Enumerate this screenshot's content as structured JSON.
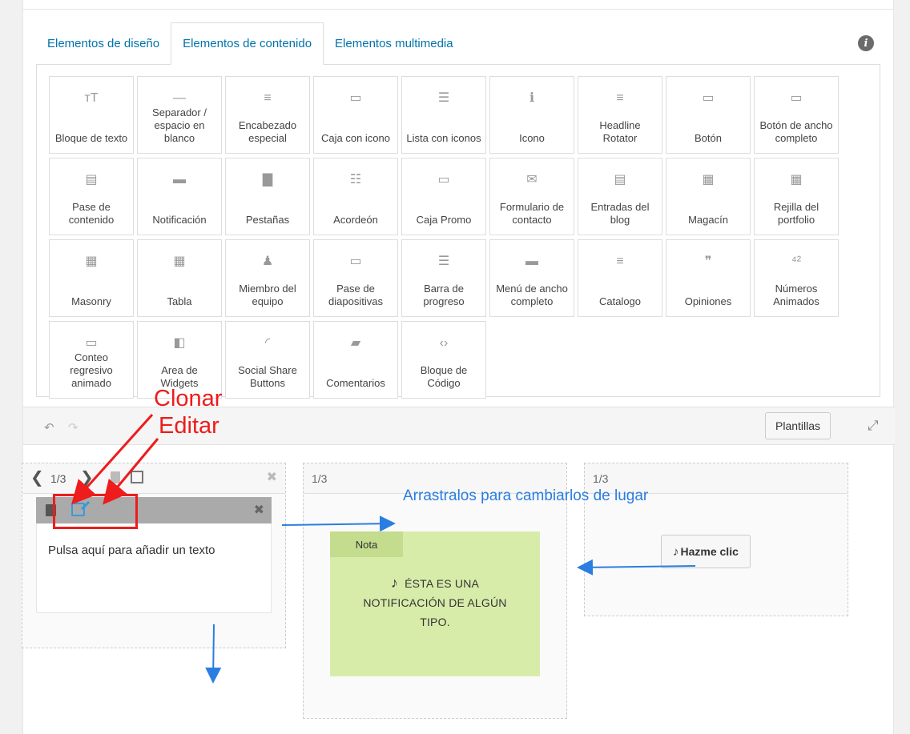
{
  "tabs": [
    {
      "label": "Elementos de diseño",
      "active": false
    },
    {
      "label": "Elementos de contenido",
      "active": true
    },
    {
      "label": "Elementos multimedia",
      "active": false
    }
  ],
  "elements": [
    {
      "label": "Bloque de texto",
      "icon": "text-block-icon",
      "glyph": "ᴛT"
    },
    {
      "label": "Separador / espacio en blanco",
      "icon": "separator-icon",
      "glyph": "—"
    },
    {
      "label": "Encabezado especial",
      "icon": "heading-icon",
      "glyph": "≡"
    },
    {
      "label": "Caja con icono",
      "icon": "icon-box-icon",
      "glyph": "▭"
    },
    {
      "label": "Lista con iconos",
      "icon": "icon-list-icon",
      "glyph": "☰"
    },
    {
      "label": "Icono",
      "icon": "info-circle-icon",
      "glyph": "ℹ"
    },
    {
      "label": "Headline Rotator",
      "icon": "headline-rotator-icon",
      "glyph": "≡"
    },
    {
      "label": "Botón",
      "icon": "button-icon",
      "glyph": "▭"
    },
    {
      "label": "Botón de ancho completo",
      "icon": "fullwidth-button-icon",
      "glyph": "▭"
    },
    {
      "label": "Pase de contenido",
      "icon": "content-slider-icon",
      "glyph": "▤"
    },
    {
      "label": "Notificación",
      "icon": "notification-icon",
      "glyph": "▬"
    },
    {
      "label": "Pestañas",
      "icon": "tabs-icon",
      "glyph": "▇"
    },
    {
      "label": "Acordeón",
      "icon": "accordion-icon",
      "glyph": "☷"
    },
    {
      "label": "Caja Promo",
      "icon": "promo-box-icon",
      "glyph": "▭"
    },
    {
      "label": "Formulario de contacto",
      "icon": "envelope-icon",
      "glyph": "✉"
    },
    {
      "label": "Entradas del blog",
      "icon": "blog-posts-icon",
      "glyph": "▤"
    },
    {
      "label": "Magacín",
      "icon": "magazine-icon",
      "glyph": "▦"
    },
    {
      "label": "Rejilla del portfolio",
      "icon": "portfolio-grid-icon",
      "glyph": "▦"
    },
    {
      "label": "Masonry",
      "icon": "masonry-icon",
      "glyph": "▦"
    },
    {
      "label": "Tabla",
      "icon": "table-icon",
      "glyph": "▦"
    },
    {
      "label": "Miembro del equipo",
      "icon": "team-member-icon",
      "glyph": "♟"
    },
    {
      "label": "Pase de diapositivas",
      "icon": "slideshow-icon",
      "glyph": "▭"
    },
    {
      "label": "Barra de progreso",
      "icon": "progress-bar-icon",
      "glyph": "☰"
    },
    {
      "label": "Menú de ancho completo",
      "icon": "fullwidth-menu-icon",
      "glyph": "▬"
    },
    {
      "label": "Catalogo",
      "icon": "catalog-icon",
      "glyph": "≡"
    },
    {
      "label": "Opiniones",
      "icon": "testimonial-icon",
      "glyph": "❞"
    },
    {
      "label": "Números Animados",
      "icon": "animated-numbers-icon",
      "glyph": "⁴²"
    },
    {
      "label": "Conteo regresivo animado",
      "icon": "countdown-icon",
      "glyph": "▭"
    },
    {
      "label": "Area de Widgets",
      "icon": "widget-area-icon",
      "glyph": "◧"
    },
    {
      "label": "Social Share Buttons",
      "icon": "social-share-icon",
      "glyph": "◜"
    },
    {
      "label": "Comentarios",
      "icon": "comments-icon",
      "glyph": "▰"
    },
    {
      "label": "Bloque de Código",
      "icon": "code-block-icon",
      "glyph": "‹›"
    }
  ],
  "toolbar": {
    "templates_label": "Plantillas"
  },
  "columns": [
    {
      "size": "1/3"
    },
    {
      "size": "1/3"
    },
    {
      "size": "1/3"
    }
  ],
  "text_block": {
    "text": "Pulsa aquí para añadir un texto"
  },
  "notification": {
    "tag": "Nota",
    "text": "ÉSTA ES UNA NOTIFICACIÓN DE ALGÚN TIPO."
  },
  "button_element": {
    "label": "Hazme clic"
  },
  "annotations": {
    "clone": "Clonar",
    "edit": "Editar",
    "drag": "Arrastralos para cambiarlos de lugar"
  },
  "colors": {
    "annotation_red": "#ee1c1c",
    "annotation_blue": "#2a7de1",
    "link_blue": "#0073aa",
    "note_bg": "#d8ecaa"
  }
}
